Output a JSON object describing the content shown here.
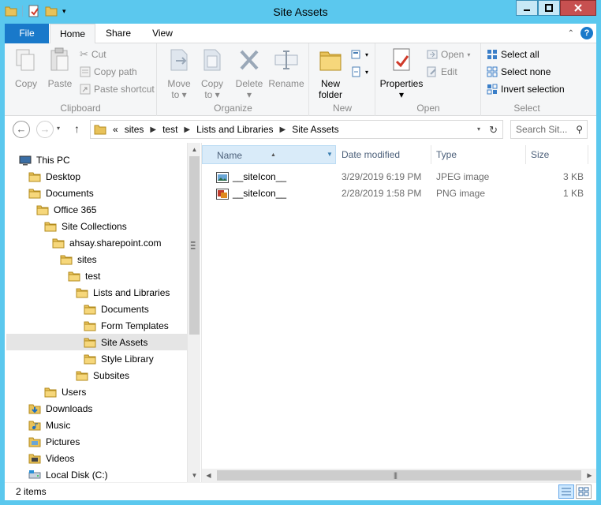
{
  "window": {
    "title": "Site Assets"
  },
  "ribbon_tabs": {
    "file": "File",
    "home": "Home",
    "share": "Share",
    "view": "View"
  },
  "ribbon": {
    "clipboard": {
      "label": "Clipboard",
      "copy": "Copy",
      "paste": "Paste",
      "cut": "Cut",
      "copy_path": "Copy path",
      "paste_shortcut": "Paste shortcut"
    },
    "organize": {
      "label": "Organize",
      "move_to_1": "Move",
      "move_to_2": "to",
      "copy_to_1": "Copy",
      "copy_to_2": "to",
      "delete": "Delete",
      "rename": "Rename"
    },
    "new": {
      "label": "New",
      "new_folder_1": "New",
      "new_folder_2": "folder"
    },
    "open": {
      "label": "Open",
      "properties": "Properties",
      "open": "Open",
      "edit": "Edit"
    },
    "select": {
      "label": "Select",
      "select_all": "Select all",
      "select_none": "Select none",
      "invert_selection": "Invert selection"
    }
  },
  "address": {
    "overflow": "«",
    "crumbs": [
      "sites",
      "test",
      "Lists and Libraries",
      "Site Assets"
    ],
    "search_placeholder": "Search Sit..."
  },
  "nav_tree": [
    {
      "label": "This PC",
      "icon": "computer-icon"
    },
    {
      "label": "Desktop",
      "icon": "folder-icon"
    },
    {
      "label": "Documents",
      "icon": "folder-icon"
    },
    {
      "label": "Office 365",
      "icon": "folder-icon"
    },
    {
      "label": "Site Collections",
      "icon": "folder-icon"
    },
    {
      "label": "ahsay.sharepoint.com",
      "icon": "folder-icon"
    },
    {
      "label": "sites",
      "icon": "folder-icon"
    },
    {
      "label": "test",
      "icon": "folder-icon"
    },
    {
      "label": "Lists and Libraries",
      "icon": "folder-icon"
    },
    {
      "label": "Documents",
      "icon": "folder-icon"
    },
    {
      "label": "Form Templates",
      "icon": "folder-icon"
    },
    {
      "label": "Site Assets",
      "icon": "folder-icon",
      "selected": true
    },
    {
      "label": "Style Library",
      "icon": "folder-icon"
    },
    {
      "label": "Subsites",
      "icon": "folder-icon"
    },
    {
      "label": "Users",
      "icon": "folder-icon"
    },
    {
      "label": "Downloads",
      "icon": "downloads-icon"
    },
    {
      "label": "Music",
      "icon": "music-icon"
    },
    {
      "label": "Pictures",
      "icon": "pictures-icon"
    },
    {
      "label": "Videos",
      "icon": "videos-icon"
    },
    {
      "label": "Local Disk (C:)",
      "icon": "drive-icon"
    }
  ],
  "file_list": {
    "columns": {
      "name": "Name",
      "date": "Date modified",
      "type": "Type",
      "size": "Size"
    },
    "rows": [
      {
        "name": "__siteIcon__",
        "date": "3/29/2019 6:19 PM",
        "type": "JPEG image",
        "size": "3 KB"
      },
      {
        "name": "__siteIcon__",
        "date": "2/28/2019 1:58 PM",
        "type": "PNG image",
        "size": "1 KB"
      }
    ]
  },
  "status": {
    "count": "2 items"
  },
  "colors": {
    "frame": "#5bc8ee",
    "file_tab": "#1979ca",
    "selection": "#e5e5e5",
    "header_selected": "#d9ebf9"
  }
}
